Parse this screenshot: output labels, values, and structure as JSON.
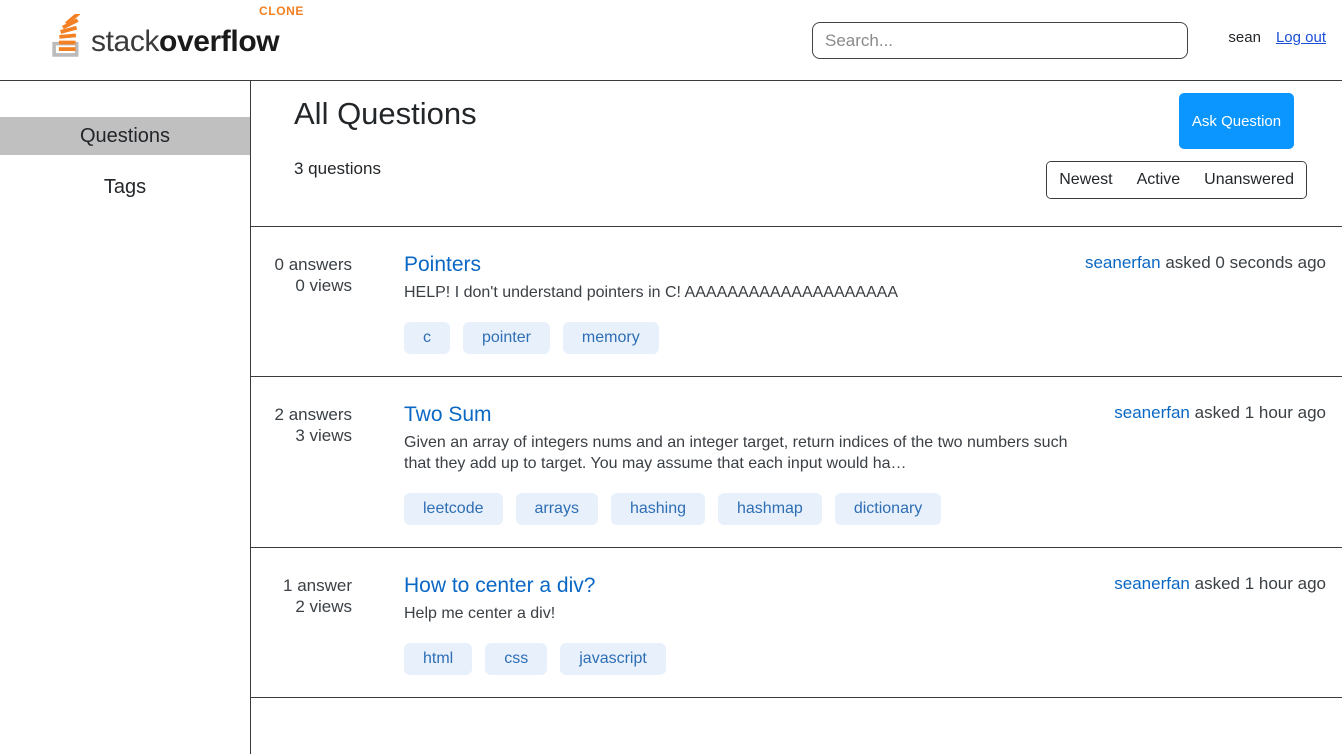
{
  "header": {
    "logo": {
      "icon": "stack-overflow-logo-icon",
      "text_light": "stack",
      "text_bold": "overflow",
      "badge": "CLONE",
      "badge_color": "#f48024"
    },
    "search": {
      "value": "",
      "placeholder": "Search..."
    },
    "username": "sean",
    "logout_label": "Log out",
    "logout_color": "#1a4fd6"
  },
  "sidebar": {
    "items": [
      {
        "label": "Questions",
        "active": true
      },
      {
        "label": "Tags",
        "active": false
      }
    ],
    "active_bg": "#c0c0c0"
  },
  "main": {
    "title": "All Questions",
    "count_text": "3 questions",
    "ask_button": "Ask Question",
    "ask_button_color": "#0a95ff",
    "filters": [
      "Newest",
      "Active",
      "Unanswered"
    ],
    "questions": [
      {
        "answers": "0 answers",
        "views": "0 views",
        "title": "Pointers",
        "excerpt": "HELP! I don't understand pointers in C! AAAAAAAAAAAAAAAAAAAA",
        "tags": [
          "c",
          "pointer",
          "memory"
        ],
        "user": "seanerfan",
        "meta": " asked 0 seconds ago"
      },
      {
        "answers": "2 answers",
        "views": "3 views",
        "title": "Two Sum",
        "excerpt": "Given an array of integers nums and an integer target, return indices of the two numbers such that they add up to target. You may assume that each input would ha…",
        "tags": [
          "leetcode",
          "arrays",
          "hashing",
          "hashmap",
          "dictionary"
        ],
        "user": "seanerfan",
        "meta": " asked 1 hour ago"
      },
      {
        "answers": "1 answer",
        "views": "2 views",
        "title": "How to center a div?",
        "excerpt": "Help me center a div!",
        "tags": [
          "html",
          "css",
          "javascript"
        ],
        "user": "seanerfan",
        "meta": " asked 1 hour ago"
      }
    ]
  }
}
